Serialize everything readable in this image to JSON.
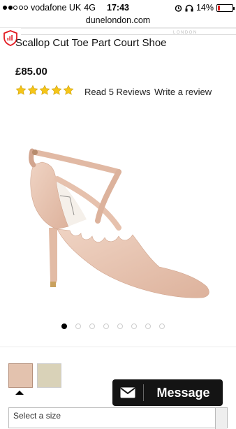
{
  "status_bar": {
    "carrier": "vodafone UK",
    "network": "4G",
    "time": "17:43",
    "battery": "14%",
    "battery_level": 0.14
  },
  "browser": {
    "url": "dunelondon.com"
  },
  "product": {
    "title": "Scallop Cut Toe Part Court Shoe",
    "price": "£85.00",
    "rating": 5,
    "rating_max": 5,
    "star_color": "#f5c518",
    "read_reviews": "Read 5 Reviews",
    "write_review": "Write a review",
    "image_color": "#e6c3b1"
  },
  "gallery": {
    "slides": 8,
    "active_index": 0
  },
  "swatches": [
    {
      "name": "blush",
      "color": "#e3c2ae",
      "selected": true
    },
    {
      "name": "gold",
      "color": "#d9d2b8",
      "selected": false
    }
  ],
  "select": {
    "value": "Select a size"
  },
  "chat": {
    "label": "Message",
    "icon": "envelope-icon"
  }
}
